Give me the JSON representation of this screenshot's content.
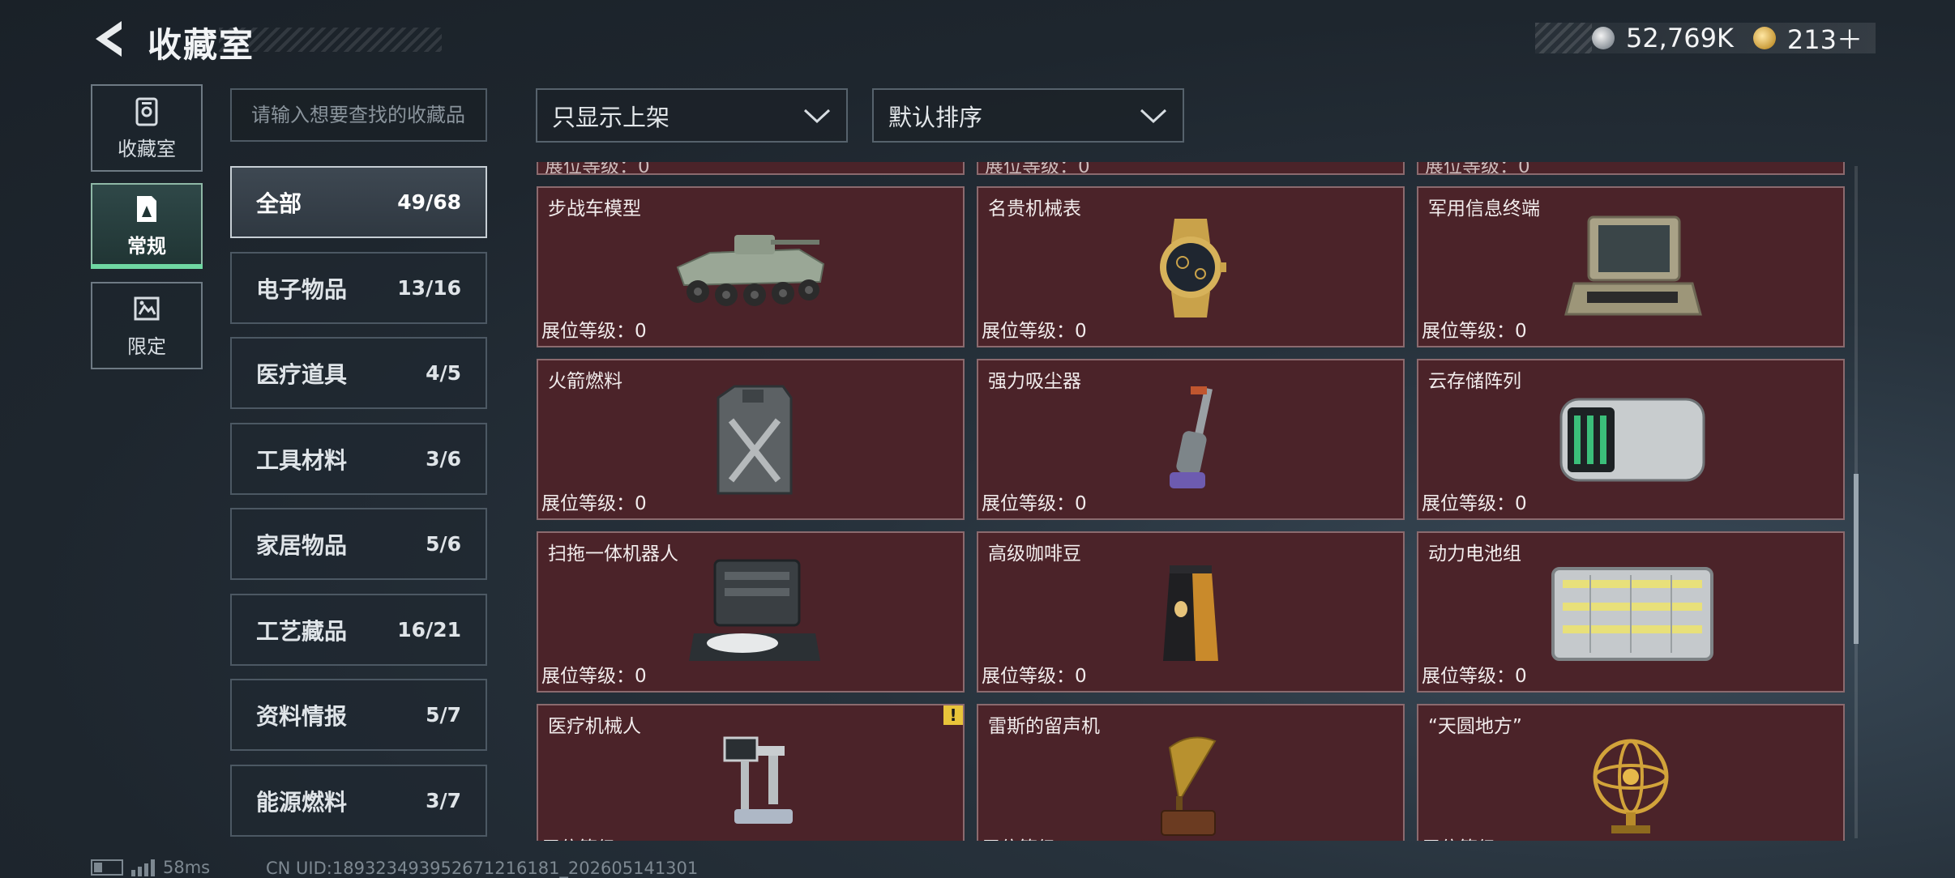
{
  "header": {
    "title": "收藏室",
    "currencies": [
      {
        "icon": "silver-coin-icon",
        "value": "52,769K"
      },
      {
        "icon": "gold-coin-icon",
        "value": "213＋"
      }
    ]
  },
  "side_tabs": [
    {
      "label": "收藏室",
      "icon": "collection-room-icon",
      "active": false
    },
    {
      "label": "常规",
      "icon": "regular-icon",
      "active": true
    },
    {
      "label": "限定",
      "icon": "limited-icon",
      "active": false
    }
  ],
  "search": {
    "placeholder": "请输入想要查找的收藏品",
    "value": ""
  },
  "filters": {
    "shelf_filter": "只显示上架",
    "sort": "默认排序"
  },
  "categories": [
    {
      "name": "全部",
      "count": "49/68"
    },
    {
      "name": "电子物品",
      "count": "13/16"
    },
    {
      "name": "医疗道具",
      "count": "4/5"
    },
    {
      "name": "工具材料",
      "count": "3/6"
    },
    {
      "name": "家居物品",
      "count": "5/6"
    },
    {
      "name": "工艺藏品",
      "count": "16/21"
    },
    {
      "name": "资料情报",
      "count": "5/7"
    },
    {
      "name": "能源燃料",
      "count": "3/7"
    }
  ],
  "level_label": "展位等级：",
  "partial_row_text": "展位等级：0",
  "items": [
    {
      "name": "步战车模型",
      "level": "0",
      "icon": "ifv-model-icon"
    },
    {
      "name": "名贵机械表",
      "level": "0",
      "icon": "luxury-watch-icon"
    },
    {
      "name": "军用信息终端",
      "level": "0",
      "icon": "military-terminal-icon"
    },
    {
      "name": "火箭燃料",
      "level": "0",
      "icon": "rocket-fuel-icon"
    },
    {
      "name": "强力吸尘器",
      "level": "0",
      "icon": "vacuum-cleaner-icon"
    },
    {
      "name": "云存储阵列",
      "level": "0",
      "icon": "cloud-storage-icon"
    },
    {
      "name": "扫拖一体机器人",
      "level": "0",
      "icon": "robot-mop-icon"
    },
    {
      "name": "高级咖啡豆",
      "level": "0",
      "icon": "coffee-beans-icon"
    },
    {
      "name": "动力电池组",
      "level": "0",
      "icon": "battery-pack-icon"
    },
    {
      "name": "医疗机械人",
      "level": "",
      "icon": "medical-robot-icon",
      "warning": "!"
    },
    {
      "name": "雷斯的留声机",
      "level": "",
      "icon": "gramophone-icon"
    },
    {
      "name": "“天圆地方”",
      "level": "",
      "icon": "armillary-sphere-icon"
    }
  ],
  "status_bar": {
    "ping": "58ms",
    "uid": "CN UID:189323493952671216181_202605141301"
  }
}
